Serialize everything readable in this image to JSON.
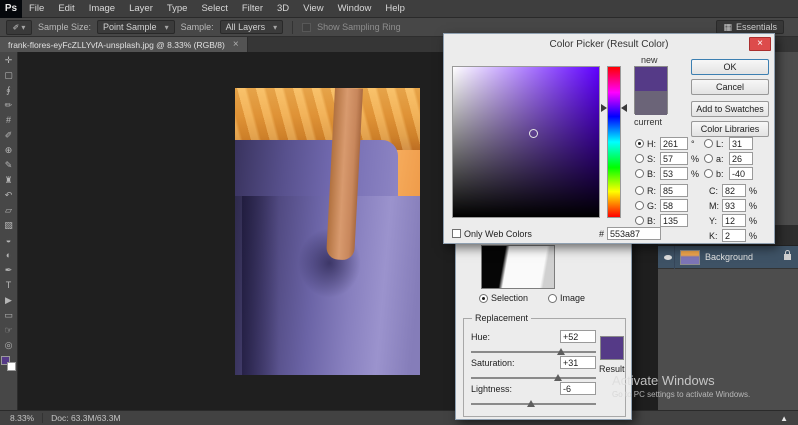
{
  "menu_bar": {
    "logo": "Ps",
    "items": [
      "File",
      "Edit",
      "Image",
      "Layer",
      "Type",
      "Select",
      "Filter",
      "3D",
      "View",
      "Window",
      "Help"
    ]
  },
  "options_bar": {
    "sample_size_label": "Sample Size:",
    "sample_size_value": "Point Sample",
    "sample_label": "Sample:",
    "sample_value": "All Layers",
    "sampling_ring_label": "Show Sampling Ring",
    "workspace_label": "Essentials"
  },
  "document_tab": {
    "title": "frank-flores-eyFcZLLYvfA-unsplash.jpg @ 8.33% (RGB/8)"
  },
  "icons": {
    "caret_down": "▾",
    "close": "×",
    "status_arrow": "▲",
    "eyedropper_preset": "✐",
    "workspace_grid": "▦"
  },
  "tools": [
    {
      "name": "move",
      "glyph": "✛"
    },
    {
      "name": "rectangular-marquee",
      "glyph": "▢"
    },
    {
      "name": "lasso",
      "glyph": "∮"
    },
    {
      "name": "quick-selection",
      "glyph": "✏"
    },
    {
      "name": "crop",
      "glyph": "#"
    },
    {
      "name": "eyedropper",
      "glyph": "✐"
    },
    {
      "name": "spot-healing",
      "glyph": "⊕"
    },
    {
      "name": "brush",
      "glyph": "✎"
    },
    {
      "name": "clone-stamp",
      "glyph": "♜"
    },
    {
      "name": "history-brush",
      "glyph": "↶"
    },
    {
      "name": "eraser",
      "glyph": "▱"
    },
    {
      "name": "gradient",
      "glyph": "▧"
    },
    {
      "name": "blur",
      "glyph": "◒"
    },
    {
      "name": "dodge",
      "glyph": "◐"
    },
    {
      "name": "pen",
      "glyph": "✒"
    },
    {
      "name": "type",
      "glyph": "T"
    },
    {
      "name": "path-selection",
      "glyph": "▶"
    },
    {
      "name": "rectangle",
      "glyph": "▭"
    },
    {
      "name": "hand",
      "glyph": "☞"
    },
    {
      "name": "zoom",
      "glyph": "◎"
    }
  ],
  "color_picker": {
    "title": "Color Picker (Result Color)",
    "labels": {
      "new": "new",
      "current": "current",
      "only_web": "Only Web Colors",
      "hex_prefix": "#"
    },
    "buttons": {
      "ok": "OK",
      "cancel": "Cancel",
      "add_to_swatches": "Add to Swatches",
      "color_libraries": "Color Libraries"
    },
    "hsb": {
      "h": {
        "label": "H:",
        "value": "261",
        "unit": "°"
      },
      "s": {
        "label": "S:",
        "value": "57",
        "unit": "%"
      },
      "b": {
        "label": "B:",
        "value": "53",
        "unit": "%"
      }
    },
    "rgb": {
      "r": {
        "label": "R:",
        "value": "85"
      },
      "g": {
        "label": "G:",
        "value": "58"
      },
      "b": {
        "label": "B:",
        "value": "135"
      }
    },
    "lab": {
      "l": {
        "label": "L:",
        "value": "31"
      },
      "a": {
        "label": "a:",
        "value": "26"
      },
      "b": {
        "label": "b:",
        "value": "-40"
      }
    },
    "cmyk": {
      "c": {
        "label": "C:",
        "value": "82",
        "unit": "%"
      },
      "m": {
        "label": "M:",
        "value": "93",
        "unit": "%"
      },
      "y": {
        "label": "Y:",
        "value": "12",
        "unit": "%"
      },
      "k": {
        "label": "K:",
        "value": "2",
        "unit": "%"
      }
    },
    "hex_value": "553a87",
    "colors": {
      "new_swatch": "#553a87",
      "current_swatch": "#6b6478"
    }
  },
  "replace_color": {
    "selection_label": "Selection",
    "image_label": "Image",
    "group_label": "Replacement",
    "rows": {
      "hue": {
        "label": "Hue:",
        "value": "+52"
      },
      "saturation": {
        "label": "Saturation:",
        "value": "+31"
      },
      "lightness": {
        "label": "Lightness:",
        "value": "-6"
      }
    },
    "result_label": "Result",
    "result_color": "#553a87"
  },
  "layers_panel": {
    "layer_name": "Background"
  },
  "status_bar": {
    "zoom": "8.33%",
    "doc_info": "Doc: 63.3M/63.3M"
  },
  "watermark": {
    "title": "Activate Windows",
    "subtitle": "Go to PC settings to activate Windows."
  }
}
